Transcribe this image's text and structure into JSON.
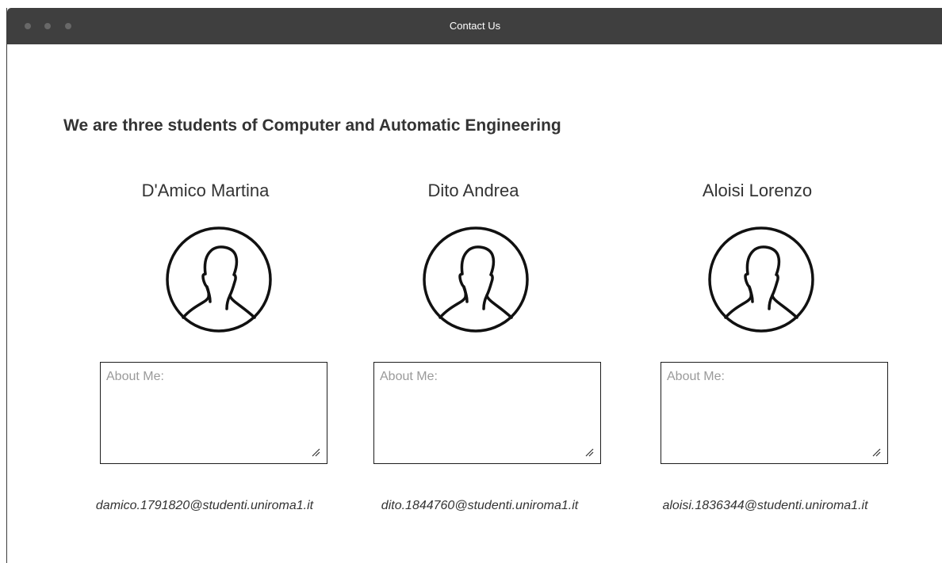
{
  "window": {
    "title": "Contact Us"
  },
  "page": {
    "heading": "We are three students of Computer and Automatic Engineering",
    "people": [
      {
        "name": "D'Amico Martina",
        "about_placeholder": "About Me:",
        "email": "damico.1791820@studenti.uniroma1.it",
        "avatar_icon": "user-icon"
      },
      {
        "name": "Dito Andrea",
        "about_placeholder": "About Me:",
        "email": "dito.1844760@studenti.uniroma1.it",
        "avatar_icon": "user-icon"
      },
      {
        "name": "Aloisi Lorenzo",
        "about_placeholder": "About Me:",
        "email": "aloisi.1836344@studenti.uniroma1.it",
        "avatar_icon": "user-icon"
      }
    ]
  }
}
